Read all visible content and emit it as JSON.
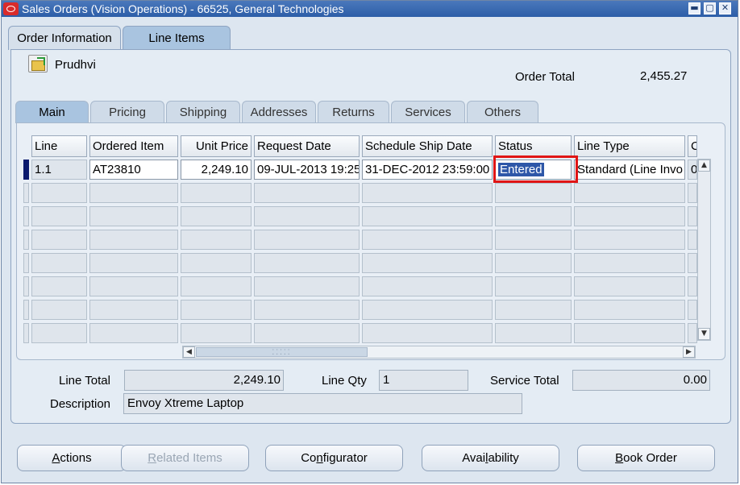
{
  "window": {
    "title": "Sales Orders (Vision Operations) - 66525, General Technologies",
    "minimize_glyph": "▬",
    "restore_glyph": "▢",
    "close_glyph": "✕"
  },
  "outer_tabs": [
    {
      "label": "Order Information",
      "active": false
    },
    {
      "label": "Line Items",
      "active": true
    }
  ],
  "header": {
    "customer_name": "Prudhvi",
    "order_total_label": "Order Total",
    "order_total_value": "2,455.27",
    "folder_icon": "folder-open-icon"
  },
  "inner_tabs": [
    {
      "label": "Main",
      "active": true
    },
    {
      "label": "Pricing",
      "active": false
    },
    {
      "label": "Shipping",
      "active": false
    },
    {
      "label": "Addresses",
      "active": false
    },
    {
      "label": "Returns",
      "active": false
    },
    {
      "label": "Services",
      "active": false
    },
    {
      "label": "Others",
      "active": false
    }
  ],
  "table": {
    "columns": [
      "Line",
      "Ordered Item",
      "Unit Price",
      "Request Date",
      "Schedule Ship Date",
      "Status",
      "Line Type",
      "C"
    ],
    "rows": [
      {
        "line": "1.1",
        "ordered_item": "AT23810",
        "unit_price": "2,249.10",
        "request_date": "09-JUL-2013 19:25",
        "schedule_ship_date": "31-DEC-2012 23:59:00",
        "status": "Entered",
        "line_type": "Standard (Line Invo",
        "c": "0"
      }
    ],
    "empty_rows": 7,
    "hscroll_grip": "⁚⁚⁚⁚⁚"
  },
  "summary": {
    "line_total_label": "Line Total",
    "line_total_value": "2,249.10",
    "line_qty_label": "Line Qty",
    "line_qty_value": "1",
    "service_total_label": "Service Total",
    "service_total_value": "0.00",
    "description_label": "Description",
    "description_value": "Envoy Xtreme Laptop"
  },
  "buttons": {
    "actions": {
      "first": "A",
      "rest": "ctions"
    },
    "related_items": {
      "first": "R",
      "rest": "elated Items",
      "disabled": true
    },
    "configurator": {
      "pre": "Co",
      "mn": "n",
      "post": "figurator"
    },
    "availability": {
      "pre": "Avai",
      "mn": "l",
      "post": "ability"
    },
    "book_order": {
      "first": "B",
      "rest": "ook Order"
    }
  },
  "colors": {
    "highlight_box": "#e01515",
    "selection": "#2e57a8",
    "titlebar": "#2d5ea8"
  }
}
